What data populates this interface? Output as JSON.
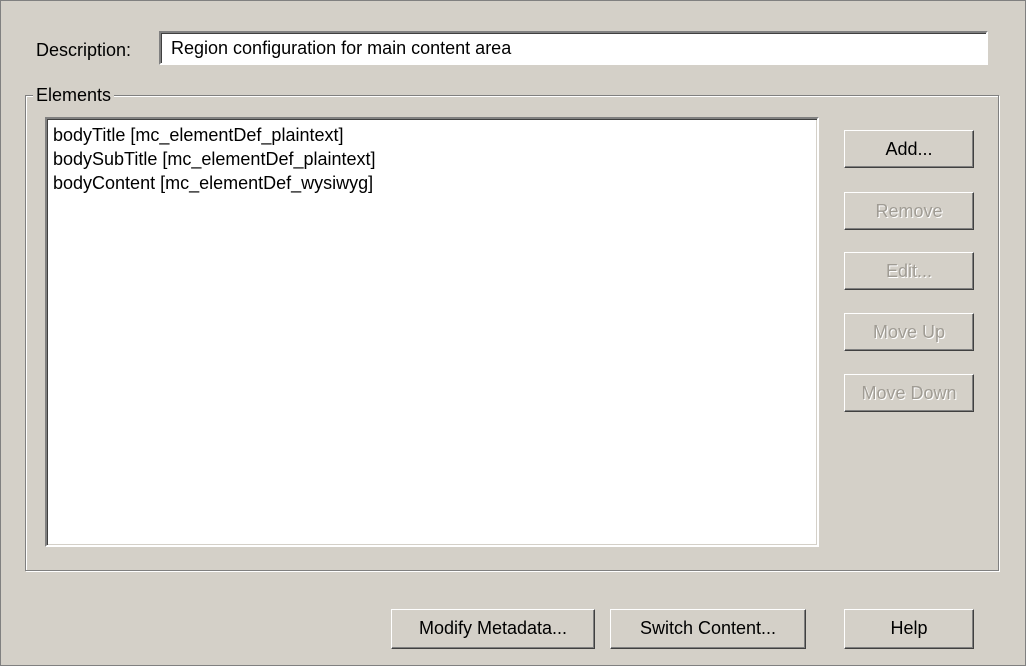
{
  "description": {
    "label": "Description:",
    "value": "Region configuration for main content area"
  },
  "elements_group": {
    "title": "Elements",
    "items": [
      "bodyTitle [mc_elementDef_plaintext]",
      "bodySubTitle [mc_elementDef_plaintext]",
      "bodyContent [mc_elementDef_wysiwyg]"
    ]
  },
  "side_buttons": {
    "add": "Add...",
    "remove": "Remove",
    "edit": "Edit...",
    "move_up": "Move Up",
    "move_down": "Move Down"
  },
  "bottom_buttons": {
    "modify_metadata": "Modify Metadata...",
    "switch_content": "Switch Content...",
    "help": "Help"
  },
  "colors": {
    "dialog_bg": "#d4d0c8",
    "disabled_text": "#a09c94"
  }
}
